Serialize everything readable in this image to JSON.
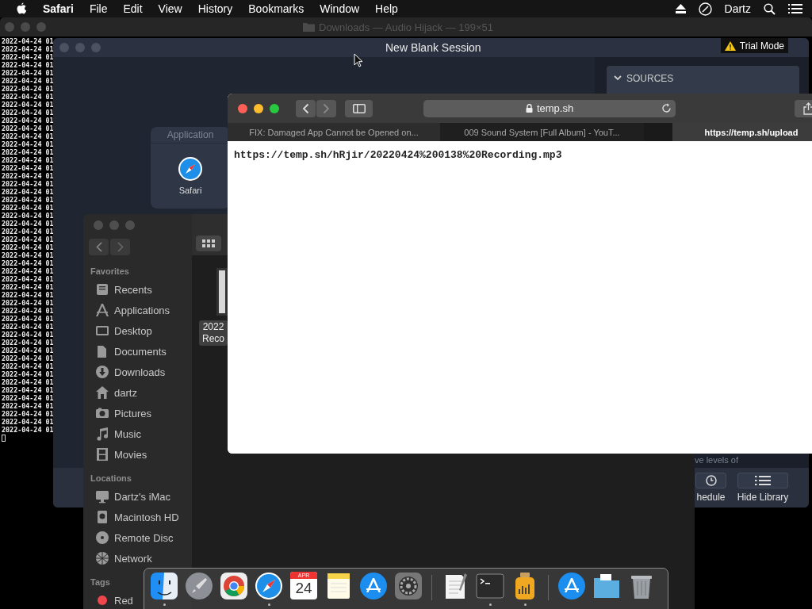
{
  "menu_bar": {
    "app_name": "Safari",
    "items": [
      "File",
      "Edit",
      "View",
      "History",
      "Bookmarks",
      "Window",
      "Help"
    ],
    "user": "Dartz"
  },
  "terminal": {
    "title": "Downloads — Audio Hijack — 199×51",
    "lines": [
      "2022-04-24 01",
      "2022-04-24 01",
      "2022-04-24 01",
      "2022-04-24 01",
      "2022-04-24 01",
      "2022-04-24 01",
      "2022-04-24 01",
      "2022-04-24 01",
      "2022-04-24 01",
      "2022-04-24 01",
      "2022-04-24 01",
      "2022-04-24 01",
      "2022-04-24 01",
      "2022-04-24 01",
      "2022-04-24 01",
      "2022-04-24 01",
      "2022-04-24 01",
      "2022-04-24 01",
      "2022-04-24 01",
      "2022-04-24 01",
      "2022-04-24 01",
      "2022-04-24 01",
      "2022-04-24 01",
      "2022-04-24 01",
      "2022-04-24 01",
      "2022-04-24 01",
      "2022-04-24 01",
      "2022-04-24 01",
      "2022-04-24 01",
      "2022-04-24 01",
      "2022-04-24 01",
      "2022-04-24 01",
      "2022-04-24 01",
      "2022-04-24 01",
      "2022-04-24 01",
      "2022-04-24 01",
      "2022-04-24 01",
      "2022-04-24 01",
      "2022-04-24 01",
      "2022-04-24 01",
      "2022-04-24 01",
      "2022-04-24 01",
      "2022-04-24 01",
      "2022-04-24 01",
      "2022-04-24 01",
      "2022-04-24 01",
      "2022-04-24 01",
      "2022-04-24 01",
      "2022-04-24 01",
      "2022-04-24 01"
    ]
  },
  "audio_hijack": {
    "title": "New Blank Session",
    "badge": "Trial Mode",
    "sources_header": "SOURCES",
    "source_block": {
      "header": "Application",
      "app": "Safari"
    },
    "hint": "ve levels of",
    "buttons": [
      {
        "label": "hedule",
        "kind": "schedule"
      },
      {
        "label": "Hide Library",
        "kind": "library"
      }
    ]
  },
  "finder": {
    "sections": [
      {
        "title": "Favorites",
        "items": [
          {
            "label": "Recents",
            "kind": "recents"
          },
          {
            "label": "Applications",
            "kind": "applications"
          },
          {
            "label": "Desktop",
            "kind": "desktop"
          },
          {
            "label": "Documents",
            "kind": "documents"
          },
          {
            "label": "Downloads",
            "kind": "downloads"
          },
          {
            "label": "dartz",
            "kind": "home"
          },
          {
            "label": "Pictures",
            "kind": "pictures"
          },
          {
            "label": "Music",
            "kind": "music"
          },
          {
            "label": "Movies",
            "kind": "movies"
          }
        ]
      },
      {
        "title": "Locations",
        "items": [
          {
            "label": "Dartz's iMac",
            "kind": "computer"
          },
          {
            "label": "Macintosh HD",
            "kind": "disk"
          },
          {
            "label": "Remote Disc",
            "kind": "disc"
          },
          {
            "label": "Network",
            "kind": "network"
          }
        ]
      },
      {
        "title": "Tags",
        "items": [
          {
            "label": "Red",
            "kind": "tag",
            "color": "#f0474c"
          }
        ]
      }
    ],
    "file_label": [
      "2022",
      "Reco"
    ]
  },
  "safari": {
    "address": "temp.sh",
    "tabs": [
      {
        "title": "FIX: Damaged App Cannot be Opened on...",
        "selected": false
      },
      {
        "title": "009 Sound System [Full Album] - YouT...",
        "selected": false
      },
      {
        "title": "https://temp.sh/upload",
        "selected": true
      }
    ],
    "page_text": "https://temp.sh/hRjir/20220424%200138%20Recording.mp3"
  },
  "dock": {
    "items": [
      {
        "kind": "finder",
        "running": true
      },
      {
        "kind": "launchpad",
        "running": false
      },
      {
        "kind": "chrome",
        "running": false
      },
      {
        "kind": "safari",
        "running": true
      },
      {
        "kind": "calendar",
        "running": false,
        "month": "APR",
        "day": "24"
      },
      {
        "kind": "notes",
        "running": false
      },
      {
        "kind": "appstore",
        "running": false
      },
      {
        "kind": "settings",
        "running": false
      },
      {
        "kind": "separator"
      },
      {
        "kind": "textedit",
        "running": false
      },
      {
        "kind": "terminal",
        "running": true
      },
      {
        "kind": "audiohijack",
        "running": true
      },
      {
        "kind": "separator"
      },
      {
        "kind": "appstore",
        "running": false
      },
      {
        "kind": "folder",
        "running": false
      },
      {
        "kind": "trash",
        "running": false
      }
    ]
  }
}
